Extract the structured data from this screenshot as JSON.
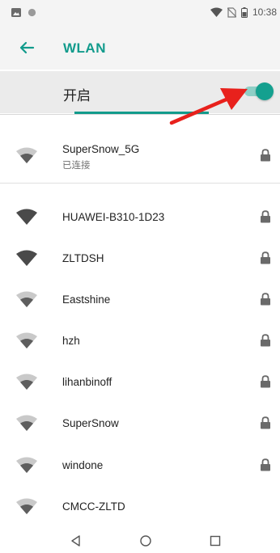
{
  "status_bar": {
    "time": "10:38",
    "left_icons": [
      "image-notification-icon",
      "dot-notification-icon"
    ],
    "right_icons": [
      "wifi-signal-icon",
      "no-sim-icon",
      "battery-icon"
    ]
  },
  "app_bar": {
    "back_icon": "arrow-left-icon",
    "title": "WLAN"
  },
  "wifi_toggle": {
    "label": "开启",
    "state": "on"
  },
  "colors": {
    "accent": "#129b8c",
    "annotation_arrow": "#e8211c"
  },
  "connected_network": {
    "name": "SuperSnow_5G",
    "status": "已连接",
    "secured": true
  },
  "networks": [
    {
      "name": "HUAWEI-B310-1D23",
      "secured": true
    },
    {
      "name": "ZLTDSH",
      "secured": true
    },
    {
      "name": "Eastshine",
      "secured": true
    },
    {
      "name": "hzh",
      "secured": true
    },
    {
      "name": "lihanbinoff",
      "secured": true
    },
    {
      "name": "SuperSnow",
      "secured": true
    },
    {
      "name": "windone",
      "secured": true
    },
    {
      "name": "CMCC-ZLTD",
      "secured": false
    }
  ],
  "nav_bar": {
    "buttons": [
      "back-triangle-icon",
      "home-circle-icon",
      "recents-square-icon"
    ]
  }
}
